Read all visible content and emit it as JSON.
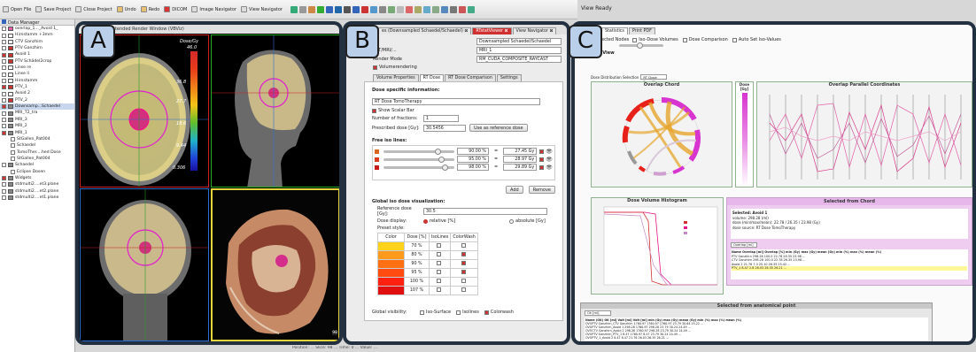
{
  "toolbar": {
    "open_file": "Open File",
    "save_project": "Save Project",
    "close_project": "Close Project",
    "undo": "Undo",
    "redo": "Redo",
    "dicom": "DICOM",
    "image_navigator": "Image Navigator",
    "view_navigator": "View Navigator"
  },
  "right_title": "View Ready",
  "data_manager": {
    "title": "Data Manager",
    "items": [
      {
        "label": "overlap_1..._Avoid 1_",
        "color": "#e35fa8",
        "checked": false
      },
      {
        "label": "Hirnstamm +3mm",
        "color": "#ffffff",
        "checked": false
      },
      {
        "label": "CTV Ganzhirn",
        "color": "#ffffff",
        "checked": false
      },
      {
        "label": "PTV Ganzhirn",
        "color": "#cc3333",
        "checked": false
      },
      {
        "label": "Avoid 1",
        "color": "#cc3333",
        "checked": true
      },
      {
        "label": "PTV Schädel2crop",
        "color": "#cc3333",
        "checked": false
      },
      {
        "label": "Linse re",
        "color": "#ffffff",
        "checked": false
      },
      {
        "label": "Linse li",
        "color": "#ffffff",
        "checked": false
      },
      {
        "label": "Hirnstamm",
        "color": "#ffffff",
        "checked": false
      },
      {
        "label": "PTV_1",
        "color": "#cc3333",
        "checked": true
      },
      {
        "label": "Avoid 2",
        "color": "#ffffff",
        "checked": false
      },
      {
        "label": "PTV_2",
        "color": "#cc3333",
        "checked": false
      },
      {
        "label": "Downsamp...Schaedel",
        "color": "#888888",
        "checked": true,
        "highlight": true
      },
      {
        "label": "MRI_T2_tra",
        "color": "#888888",
        "checked": false
      },
      {
        "label": "MRI_3",
        "color": "#888888",
        "checked": false
      },
      {
        "label": "MRI_2",
        "color": "#888888",
        "checked": false
      },
      {
        "label": "MRI_1",
        "color": "#888888",
        "checked": true
      },
      {
        "label": "StGallen_Pat004",
        "color": "",
        "checked": false
      },
      {
        "label": "Schaedel",
        "color": "",
        "checked": false
      },
      {
        "label": "TomoTher....hed Dose",
        "color": "",
        "checked": false
      },
      {
        "label": "StGallen_Pat004",
        "color": "",
        "checked": false
      },
      {
        "label": "Schaedel",
        "color": "#888888",
        "checked": false
      },
      {
        "label": "Eclipse Dosen",
        "color": "",
        "checked": false
      },
      {
        "label": "Widgets",
        "color": "#888888",
        "checked": true
      },
      {
        "label": "stdmulti2....et3.plane",
        "color": "#888888",
        "checked": false
      },
      {
        "label": "stdmulti2....et2.plane",
        "color": "#888888",
        "checked": false
      },
      {
        "label": "stdmulti2....et1.plane",
        "color": "#888888",
        "checked": false
      }
    ]
  },
  "panelA": {
    "tab_title": "xtended Render Window (VBViz)",
    "colorbar_title": "Dose/Gy",
    "ticks": [
      "46.0",
      "36.8",
      "27.7",
      "18.6",
      "9.44",
      "0.306"
    ],
    "slice_num": "98"
  },
  "panelB": {
    "tabs": [
      "es (Downsampled Schaedel/Schaedel) ⊠",
      "RTstatViewer ⊠",
      "View Navigator ⊠"
    ],
    "image_select": "Downsampled Schaedel/Schaedel",
    "pet_label": "PET/MRI/...",
    "pet_value": "MRI_1",
    "render_mode_label": "Render Mode",
    "render_mode_value": "RM_CUDA_COMPOSITE_RAYCAST",
    "volume_rendering": "Volumerendering",
    "subtabs": [
      "Volume Properties",
      "RT Dose",
      "RT Dose Comparison",
      "Settings"
    ],
    "dose_info_title": "Dose specific information:",
    "dose_select": "RT Dose TomoTherapy",
    "show_scalar_bar": "Show Scalar Bar",
    "fractions_label": "Number of fractions:",
    "fractions_value": "1",
    "prescribed_label": "Prescribed dose [Gy]:",
    "prescribed_value": "30.5456",
    "use_ref": "Use as reference dose",
    "free_iso_title": "Free iso lines:",
    "free_iso": [
      {
        "percent": "90.00 %",
        "gy": "27.45 Gy",
        "color": "#d9661f"
      },
      {
        "percent": "95.00 %",
        "gy": "28.97 Gy",
        "color": "#d93a1f"
      },
      {
        "percent": "98.00 %",
        "gy": "29.89 Gy",
        "color": "#c81919"
      }
    ],
    "add": "Add",
    "remove": "Remove",
    "global_iso_title": "Global iso dose visualization:",
    "ref_dose_label": "Reference dose [Gy]:",
    "ref_dose_value": "30.5",
    "dose_display_label": "Dose display:",
    "relative": "relative [%]",
    "absolute": "absolute [Gy]",
    "preset_label": "Preset style:",
    "cols": [
      "Color",
      "Dose [%]",
      "IsoLines",
      "ColorWash"
    ],
    "presets": [
      {
        "color": "#ffd21c",
        "dose": "70 %",
        "iso": false,
        "wash": false
      },
      {
        "color": "#ff9a1c",
        "dose": "80 %",
        "iso": false,
        "wash": true
      },
      {
        "color": "#ff7014",
        "dose": "90 %",
        "iso": false,
        "wash": true
      },
      {
        "color": "#ff4a10",
        "dose": "95 %",
        "iso": false,
        "wash": true
      },
      {
        "color": "#ff2010",
        "dose": "100 %",
        "iso": false,
        "wash": false
      },
      {
        "color": "#e01010",
        "dose": "107 %",
        "iso": false,
        "wash": false
      }
    ],
    "global_vis_label": "Global visibility:",
    "vis_opts": [
      "Iso-Surface",
      "Isolines",
      "Colorwash"
    ]
  },
  "panelC": {
    "tabs": [
      "Statistics",
      "Print PDF"
    ],
    "opts": [
      "ected Nodes",
      "Iso-Dose Volumes",
      "Dose Comparison",
      "Auto Set Iso-Values"
    ],
    "view_title": "Statistics View",
    "dose_sel_label": "Dose Distribution Selection",
    "dose_sel_value": "RT Dose TomoTherap",
    "chord_title": "Overlap Chord",
    "dose_legend_title": "Dose [Gy]",
    "parallel_title": "Overlap Parallel Coordinates",
    "dvh_title": "Dose Volume Histogram",
    "sel_chord_title": "Selected from Chord",
    "chord_info": [
      "Selected: Avoid 1",
      "volume: 298.28 (ml)",
      "dose (min/max/mean): 22.78 / 26.35 / 23.98 (Gy)",
      "dose source: RT Dose TomoTherapy"
    ],
    "overlap_select": "Overlap [ml]",
    "overlap_table": [
      "Name   Overlap [ml]   Overlap [%]   min (Gy)   max (Gy)   mean (Gy)   min (%)   max (%)   mean (%)",
      "PTV Ganzhirn   298.28   100.0   22.78   26.35   23.98   ...",
      "CTV Ganzhirn   298.28   100.0   22.78   26.35   23.98   ...",
      "Avoid 2   21.76   7.3   25.10   26.35   25.42   ...",
      "PTV_1   8.47   2.8   26.03   26.35   26.21   ..."
    ],
    "anat_title": "Selected from anatomical point",
    "anat_select": "Ok [ml]",
    "anat_table": [
      "Name (OK)   OK [ml]   Volt [ml]   Volt [ml]   min (Gy)   max (Gy)   mean (Gy)   min (%)   max (%)   mean (%)",
      "OVOPTV Ganzhirn_CTV Ganzhirn   1760.97   1760.97   1760.97   23.79   30.64   25.22 ...",
      "OVOPTV Ganzhirn_Avoid 1   298.28   1760.97   298.28   23.79   30.24   24.49 ...",
      "OVOCTV Ganzhirn_Avoid 2   298.28   1760.97   298.28   23.79   30.24   24.49 ...",
      "OVOPTV Ganzhirn_PTV_1   8.47   1760.97   8.47   23.79   30.24   24.49 ...",
      "OVOPTV_1_Avoid 2   8.47   8.47   21.76   26.03   26.35   26.21 ..."
    ]
  },
  "labels": [
    "A",
    "B",
    "C"
  ],
  "status": "Position: ... Slice: 98 ... Time: 0 ... Value: ..."
}
